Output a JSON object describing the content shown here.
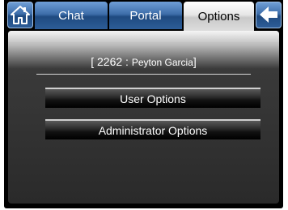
{
  "tabs": {
    "chat": "Chat",
    "portal": "Portal",
    "options": "Options",
    "active": "Options"
  },
  "user": {
    "open_bracket": "[",
    "id": "2262",
    "separator": ":",
    "name": "Peyton Garcia",
    "close_bracket": "]"
  },
  "menu": {
    "user_options": "User Options",
    "admin_options": "Administrator Options"
  },
  "icons": {
    "home": "home-icon",
    "back": "back-arrow-icon"
  },
  "colors": {
    "tab_active": "#dddddd",
    "tab_inactive": "#3e6eaa",
    "button": "#111111"
  }
}
